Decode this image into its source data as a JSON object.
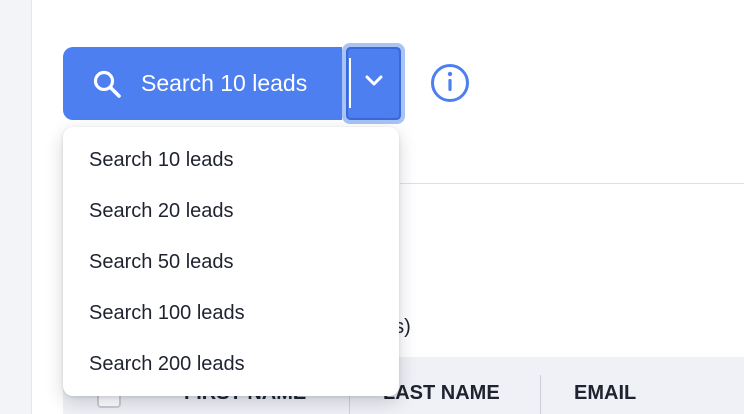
{
  "colors": {
    "primary": "#4d7ff1",
    "menu_background": "#ffffff",
    "table_header_background": "#eff1f6"
  },
  "search_button": {
    "label": "Search 10 leads",
    "icon": "search-icon",
    "toggle_icon": "chevron-down-icon"
  },
  "info_button": {
    "icon": "info-icon"
  },
  "background_text": "ds)",
  "dropdown": {
    "options": [
      "Search 10 leads",
      "Search 20 leads",
      "Search 50 leads",
      "Search 100 leads",
      "Search 200 leads"
    ]
  },
  "table": {
    "columns": [
      "FIRST NAME",
      "LAST NAME",
      "EMAIL"
    ]
  }
}
